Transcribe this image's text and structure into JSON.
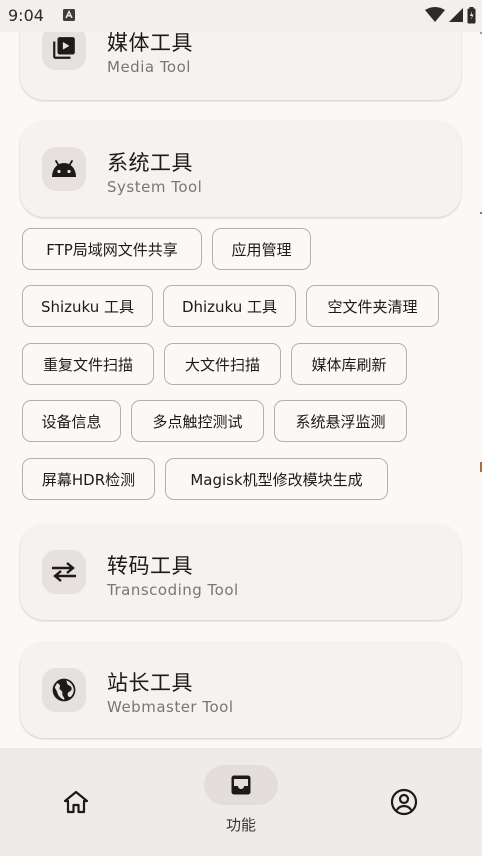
{
  "status_bar": {
    "time": "9:04"
  },
  "cards": {
    "media": {
      "title": "媒体工具",
      "subtitle": "Media Tool",
      "icon": "play-library-icon"
    },
    "system": {
      "title": "系统工具",
      "subtitle": "System Tool",
      "icon": "android-icon"
    },
    "transcoding": {
      "title": "转码工具",
      "subtitle": "Transcoding Tool",
      "icon": "swap-arrows-icon"
    },
    "webmaster": {
      "title": "站长工具",
      "subtitle": "Webmaster Tool",
      "icon": "globe-icon"
    }
  },
  "system_tools": [
    "FTP局域网文件共享",
    "应用管理",
    "Shizuku 工具",
    "Dhizuku 工具",
    "空文件夹清理",
    "重复文件扫描",
    "大文件扫描",
    "媒体库刷新",
    "设备信息",
    "多点触控测试",
    "系统悬浮监测",
    "屏幕HDR检测",
    "Magisk机型修改模块生成"
  ],
  "bottom_nav": {
    "active_label": "功能",
    "items": [
      "home-icon",
      "inbox-icon",
      "account-icon"
    ]
  },
  "colors": {
    "background": "#fbf8f6",
    "card": "#f5f2f0",
    "nav": "#efebe8",
    "chip_border": "#b6b0ac"
  }
}
